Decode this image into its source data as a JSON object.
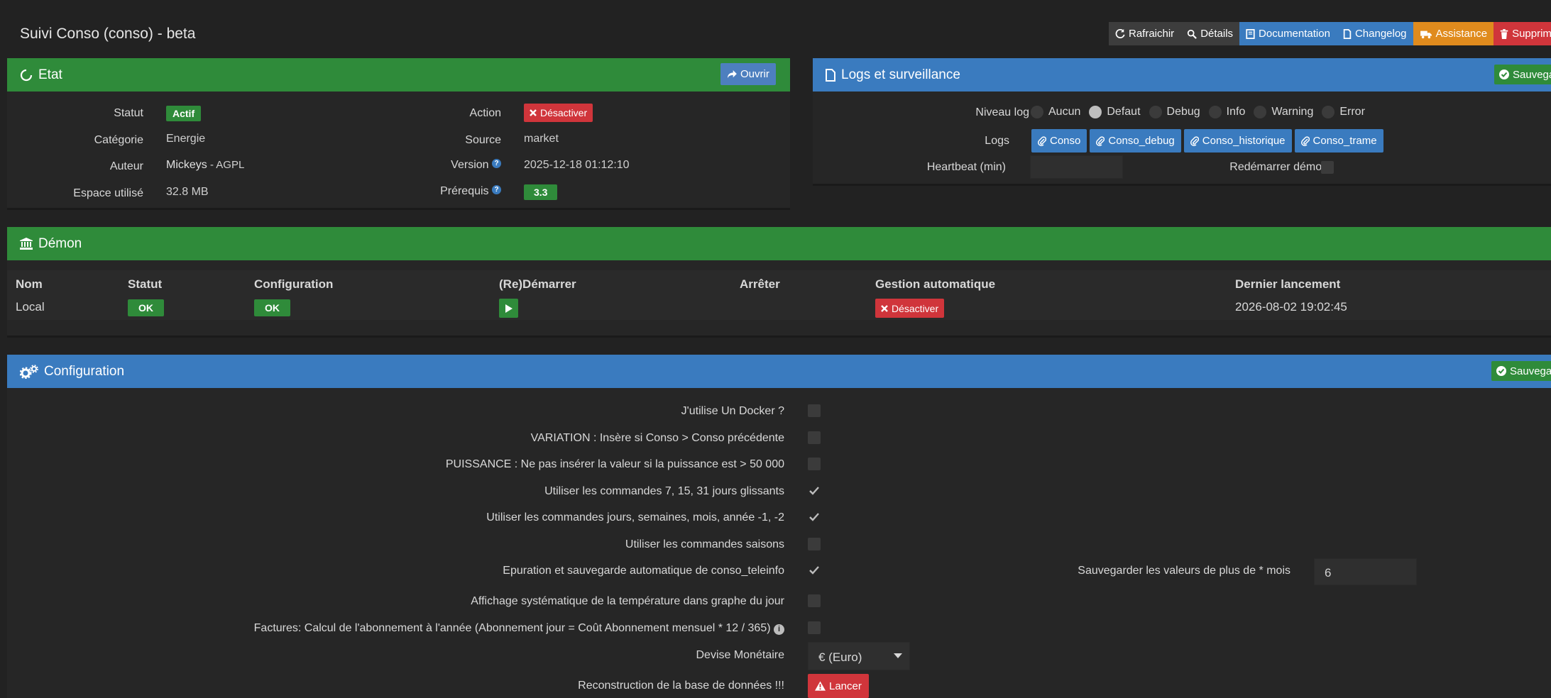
{
  "page": {
    "title": "Suivi Conso (conso) - beta"
  },
  "top_actions": {
    "refresh": "Rafraichir",
    "details": "Détails",
    "documentation": "Documentation",
    "changelog": "Changelog",
    "assistance": "Assistance",
    "delete": "Supprim"
  },
  "etat": {
    "title": "Etat",
    "open_label": "Ouvrir",
    "statut_label": "Statut",
    "statut_value": "Actif",
    "categorie_label": "Catégorie",
    "categorie_value": "Energie",
    "auteur_label": "Auteur",
    "auteur_name": "Mickeys",
    "auteur_license": " - AGPL",
    "espace_label": "Espace utilisé",
    "espace_value": "32.8 MB",
    "action_label": "Action",
    "action_button": "Désactiver",
    "source_label": "Source",
    "source_value": "market",
    "version_label": "Version",
    "version_value": "2025-12-18 01:12:10",
    "prerequis_label": "Prérequis",
    "prerequis_value": "3.3"
  },
  "logs": {
    "title": "Logs et surveillance",
    "save_label": "Sauvega",
    "niveau_label": "Niveau log",
    "levels": [
      "Aucun",
      "Defaut",
      "Debug",
      "Info",
      "Warning",
      "Error"
    ],
    "logs_label": "Logs",
    "log_buttons": [
      "Conso",
      "Conso_debug",
      "Conso_historique",
      "Conso_trame"
    ],
    "heartbeat_label": "Heartbeat (min)",
    "restart_label": "Redémarrer démon"
  },
  "demon": {
    "title": "Démon",
    "headers": [
      "Nom",
      "Statut",
      "Configuration",
      "(Re)Démarrer",
      "Arrêter",
      "Gestion automatique",
      "Dernier lancement"
    ],
    "row": {
      "nom": "Local",
      "statut": "OK",
      "configuration": "OK",
      "gestion": "Désactiver",
      "dernier": "2026-08-02 19:02:45"
    }
  },
  "configuration": {
    "title": "Configuration",
    "save_label": "Sauvega",
    "options": [
      "J'utilise Un Docker ?",
      "VARIATION : Insère si Conso > Conso précédente",
      "PUISSANCE : Ne pas insérer la valeur si la puissance est > 50 000",
      "Utiliser les commandes 7, 15, 31 jours glissants",
      "Utiliser les commandes jours, semaines, mois, année -1, -2",
      "Utiliser les commandes saisons",
      "Epuration et sauvegarde automatique de conso_teleinfo",
      "Affichage systématique de la température dans graphe du jour",
      "Factures: Calcul de l'abonnement à l'année (Abonnement jour = Coût Abonnement mensuel * 12 / 365)"
    ],
    "save_values_label": "Sauvegarder les valeurs de plus de * mois",
    "save_values_value": "6",
    "devise_label": "Devise Monétaire",
    "devise_value": "€ (Euro)",
    "rebuild_label": "Reconstruction de la base de données !!!",
    "rebuild_button": "Lancer"
  },
  "colors": {
    "green": "#2f8b3a",
    "blue": "#3a7bbf",
    "red": "#d0353b",
    "orange": "#e08b1d",
    "background": "#222222"
  }
}
